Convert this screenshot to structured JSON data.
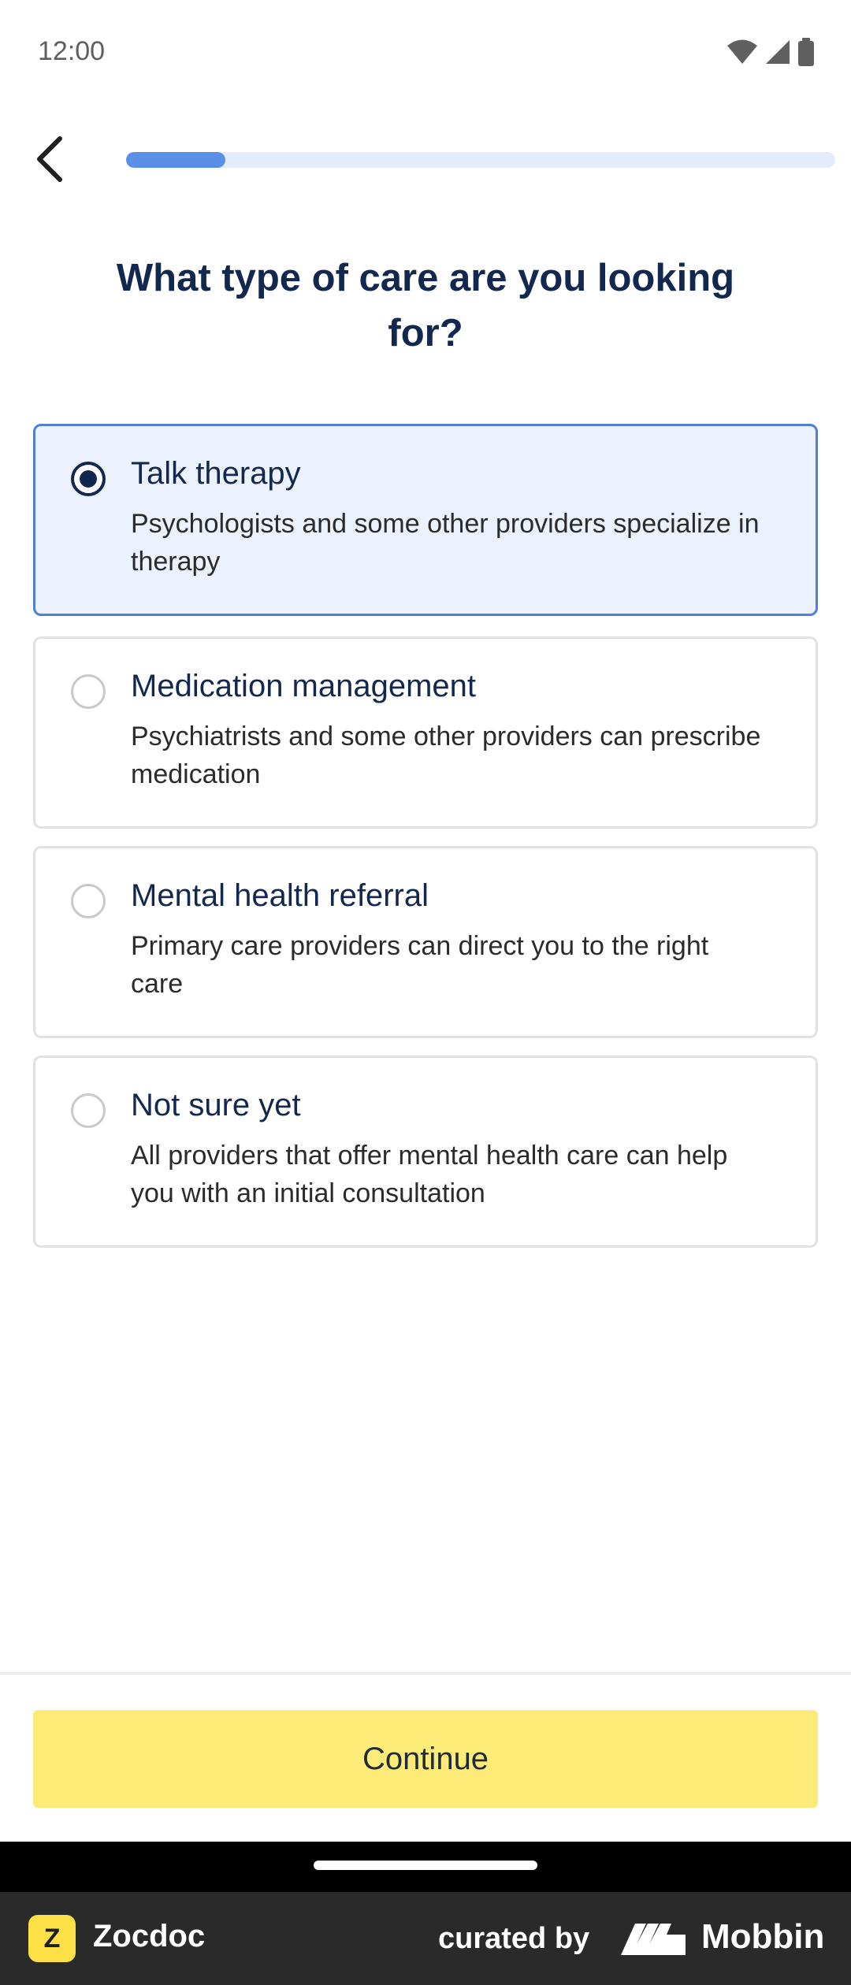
{
  "status_bar": {
    "time": "12:00",
    "icons": [
      "wifi-icon",
      "signal-icon",
      "battery-icon"
    ]
  },
  "header": {
    "back_icon": "chevron-left-icon",
    "progress": 0.14
  },
  "question": {
    "title": "What type of care are you looking for?"
  },
  "options": [
    {
      "title": "Talk therapy",
      "description": "Psychologists and some other providers specialize in therapy",
      "selected": true
    },
    {
      "title": "Medication management",
      "description": "Psychiatrists and some other providers can prescribe medication",
      "selected": false
    },
    {
      "title": "Mental health referral",
      "description": "Primary care providers can direct you to the right care",
      "selected": false
    },
    {
      "title": "Not sure yet",
      "description": "All providers that offer mental health care can help you with an initial consultation",
      "selected": false
    }
  ],
  "footer": {
    "continue_label": "Continue"
  },
  "brand_strip": {
    "app_logo_letter": "Z",
    "app_name": "Zocdoc",
    "curated_label": "curated by",
    "curator_name": "Mobbin"
  },
  "colors": {
    "accent_blue": "#5b8ee6",
    "selected_bg": "#ecf2fd",
    "selected_border": "#4f7fd6",
    "title_navy": "#13284e",
    "continue_yellow": "#fceb77"
  }
}
